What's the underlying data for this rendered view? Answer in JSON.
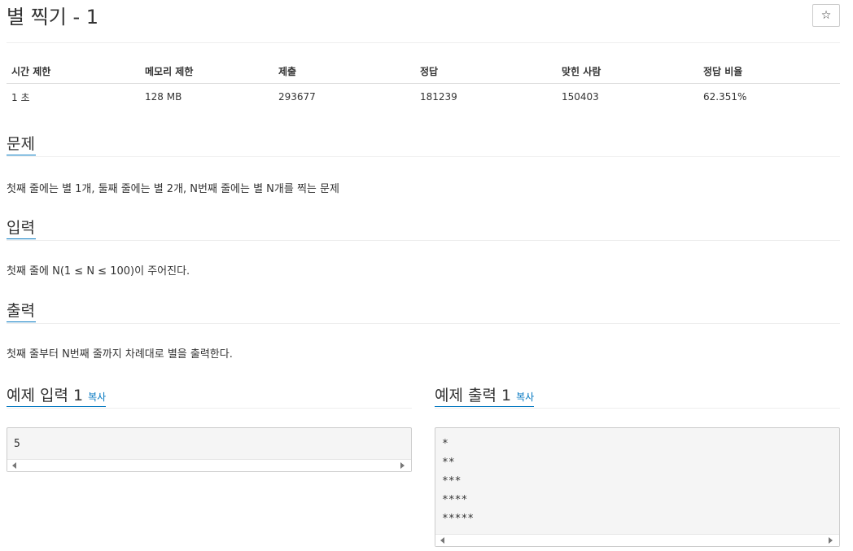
{
  "problem": {
    "title": "별 찍기 - 1",
    "star_icon": "☆"
  },
  "info_table": {
    "headers": [
      "시간 제한",
      "메모리 제한",
      "제출",
      "정답",
      "맞힌 사람",
      "정답 비율"
    ],
    "values": [
      "1 초",
      "128 MB",
      "293677",
      "181239",
      "150403",
      "62.351%"
    ]
  },
  "sections": {
    "problem": {
      "heading": "문제",
      "text": "첫째 줄에는 별 1개, 둘째 줄에는 별 2개, N번째 줄에는 별 N개를 찍는 문제"
    },
    "input": {
      "heading": "입력",
      "text": "첫째 줄에 N(1 ≤ N ≤ 100)이 주어진다."
    },
    "output": {
      "heading": "출력",
      "text": "첫째 줄부터 N번째 줄까지 차례대로 별을 출력한다."
    }
  },
  "example_input": {
    "heading": "예제 입력 1",
    "copy_label": "복사",
    "lines": [
      "5"
    ]
  },
  "example_output": {
    "heading": "예제 출력 1",
    "copy_label": "복사",
    "lines": [
      "*",
      "**",
      "***",
      "****",
      "*****"
    ]
  }
}
